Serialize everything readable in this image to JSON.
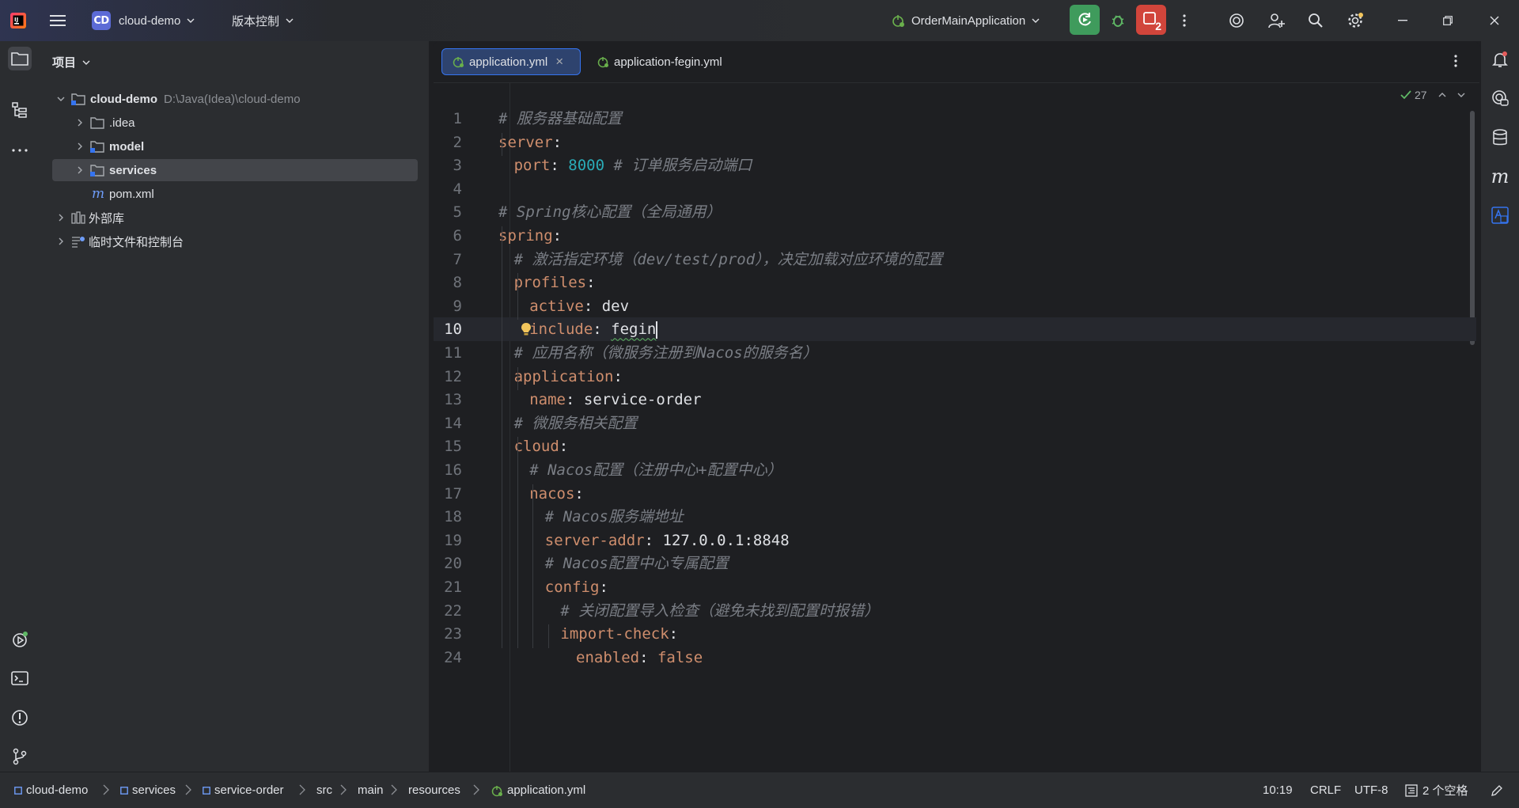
{
  "titlebar": {
    "project_badge": "CD",
    "project_name": "cloud-demo",
    "vcs_label": "版本控制",
    "run_config": "OrderMainApplication",
    "stop_badge_count": "2"
  },
  "project_panel": {
    "title": "项目",
    "tree": [
      {
        "label": "cloud-demo",
        "hint": "D:\\Java(Idea)\\cloud-demo"
      },
      {
        "label": ".idea"
      },
      {
        "label": "model"
      },
      {
        "label": "services"
      },
      {
        "label": "pom.xml"
      },
      {
        "label": "外部库"
      },
      {
        "label": "临时文件和控制台"
      }
    ]
  },
  "editor": {
    "tabs": [
      {
        "label": "application.yml",
        "close": "×"
      },
      {
        "label": "application-fegin.yml"
      }
    ],
    "inspection_count": "27",
    "current_line": 10,
    "lines": [
      {
        "n": "1",
        "key": "",
        "sep": "",
        "value": "",
        "comment": "# 服务器基础配置"
      },
      {
        "n": "2",
        "key": "server",
        "sep": ":",
        "value": "",
        "comment": ""
      },
      {
        "n": "3",
        "key": "port",
        "sep": ": ",
        "value": "8000",
        "comment": " # 订单服务启动端口"
      },
      {
        "n": "4",
        "key": "",
        "sep": "",
        "value": "",
        "comment": ""
      },
      {
        "n": "5",
        "key": "",
        "sep": "",
        "value": "",
        "comment": "# Spring核心配置（全局通用）"
      },
      {
        "n": "6",
        "key": "spring",
        "sep": ":",
        "value": "",
        "comment": ""
      },
      {
        "n": "7",
        "key": "",
        "sep": "",
        "value": "",
        "comment": "# 激活指定环境（dev/test/prod），决定加载对应环境的配置"
      },
      {
        "n": "8",
        "key": "profiles",
        "sep": ":",
        "value": "",
        "comment": ""
      },
      {
        "n": "9",
        "key": "active",
        "sep": ": ",
        "value": "dev",
        "comment": ""
      },
      {
        "n": "10",
        "key": "include",
        "sep": ": ",
        "value": "fegin",
        "comment": ""
      },
      {
        "n": "11",
        "key": "",
        "sep": "",
        "value": "",
        "comment": "# 应用名称（微服务注册到Nacos的服务名）"
      },
      {
        "n": "12",
        "key": "application",
        "sep": ":",
        "value": "",
        "comment": ""
      },
      {
        "n": "13",
        "key": "name",
        "sep": ": ",
        "value": "service-order",
        "comment": ""
      },
      {
        "n": "14",
        "key": "",
        "sep": "",
        "value": "",
        "comment": "# 微服务相关配置"
      },
      {
        "n": "15",
        "key": "cloud",
        "sep": ":",
        "value": "",
        "comment": ""
      },
      {
        "n": "16",
        "key": "",
        "sep": "",
        "value": "",
        "comment": "# Nacos配置（注册中心+配置中心）"
      },
      {
        "n": "17",
        "key": "nacos",
        "sep": ":",
        "value": "",
        "comment": ""
      },
      {
        "n": "18",
        "key": "",
        "sep": "",
        "value": "",
        "comment": "# Nacos服务端地址"
      },
      {
        "n": "19",
        "key": "server-addr",
        "sep": ": ",
        "value": "127.0.0.1:8848",
        "comment": ""
      },
      {
        "n": "20",
        "key": "",
        "sep": "",
        "value": "",
        "comment": "# Nacos配置中心专属配置"
      },
      {
        "n": "21",
        "key": "config",
        "sep": ":",
        "value": "",
        "comment": ""
      },
      {
        "n": "22",
        "key": "",
        "sep": "",
        "value": "",
        "comment": "# 关闭配置导入检查（避免未找到配置时报错）"
      },
      {
        "n": "23",
        "key": "import-check",
        "sep": ":",
        "value": "",
        "comment": ""
      },
      {
        "n": "24",
        "key": "enabled",
        "sep": ": ",
        "value": "false",
        "comment": ""
      }
    ]
  },
  "statusbar": {
    "breadcrumbs": [
      "cloud-demo",
      "services",
      "service-order",
      "src",
      "main",
      "resources",
      "application.yml"
    ],
    "position": "10:19",
    "line_ending": "CRLF",
    "encoding": "UTF-8",
    "indent": "2 个空格"
  },
  "colors": {
    "accent": "#3574f0",
    "run_green": "#3f9b5c",
    "stop_red": "#d1453b",
    "yaml_key": "#cf8e6d",
    "comment": "#7a7e85",
    "number": "#2aacb8"
  }
}
